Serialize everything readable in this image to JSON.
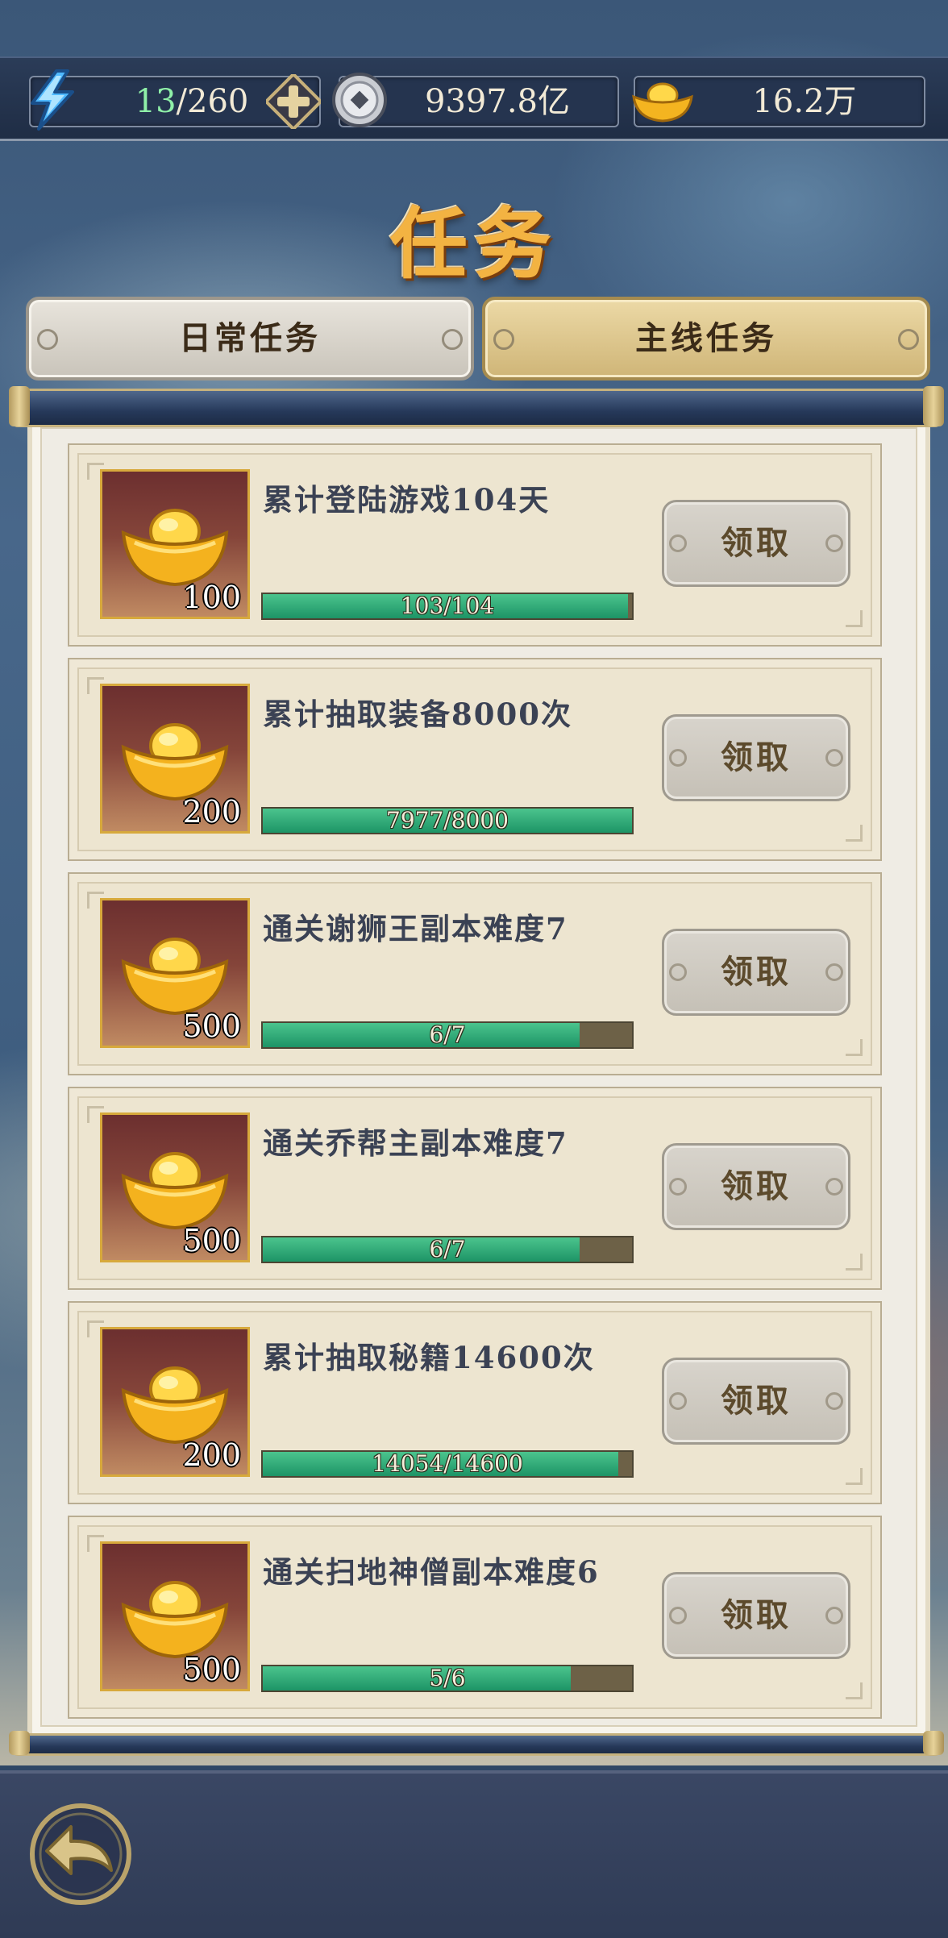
{
  "resources": {
    "energy_current": "13",
    "energy_max": "/260",
    "silver": "9397.8亿",
    "gold": "16.2万"
  },
  "title": "任务",
  "tabs": [
    {
      "label": "日常任务",
      "active": false
    },
    {
      "label": "主线任务",
      "active": true
    }
  ],
  "tasks": [
    {
      "name": "累计登陆游戏104天",
      "reward": "100",
      "progress_text": "103/104",
      "progress": 0.99,
      "button": "领取"
    },
    {
      "name": "累计抽取装备8000次",
      "reward": "200",
      "progress_text": "7977/8000",
      "progress": 1.0,
      "button": "领取"
    },
    {
      "name": "通关谢狮王副本难度7",
      "reward": "500",
      "progress_text": "6/7",
      "progress": 0.857,
      "button": "领取"
    },
    {
      "name": "通关乔帮主副本难度7",
      "reward": "500",
      "progress_text": "6/7",
      "progress": 0.857,
      "button": "领取"
    },
    {
      "name": "累计抽取秘籍14600次",
      "reward": "200",
      "progress_text": "14054/14600",
      "progress": 0.963,
      "button": "领取"
    },
    {
      "name": "通关扫地神僧副本难度6",
      "reward": "500",
      "progress_text": "5/6",
      "progress": 0.833,
      "button": "领取"
    }
  ],
  "icons": {
    "energy": "lightning-icon",
    "add": "plus-icon",
    "silver": "coin-icon",
    "gold": "gold-ingot-icon",
    "back": "back-arrow-icon"
  },
  "colors": {
    "accent_gold": "#f3b342",
    "progress_green": "#2aa874",
    "energy_green": "#8ff0a8"
  }
}
